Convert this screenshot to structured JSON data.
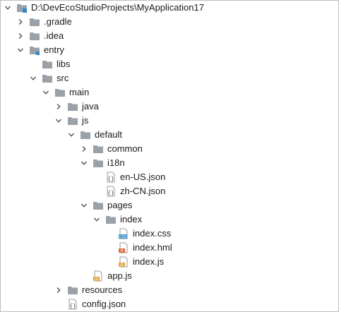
{
  "colors": {
    "folder": "#9aa1a8",
    "arrow": "#4a4a4a",
    "module_dot": "#2f88c9",
    "css_badge": "#3a8fc7",
    "hml_badge": "#e06a3b",
    "js_badge": "#e1a63a",
    "json_border": "#9a9a9a"
  },
  "tree": [
    {
      "label": "D:\\DevEcoStudioProjects\\MyApplication17",
      "depth": 0,
      "arrow": "down",
      "icon": "project-folder-icon"
    },
    {
      "label": ".gradle",
      "depth": 1,
      "arrow": "right",
      "icon": "folder-icon"
    },
    {
      "label": ".idea",
      "depth": 1,
      "arrow": "right",
      "icon": "folder-icon"
    },
    {
      "label": "entry",
      "depth": 1,
      "arrow": "down",
      "icon": "module-folder-icon"
    },
    {
      "label": "libs",
      "depth": 2,
      "arrow": "none",
      "icon": "folder-icon"
    },
    {
      "label": "src",
      "depth": 2,
      "arrow": "down",
      "icon": "folder-icon"
    },
    {
      "label": "main",
      "depth": 3,
      "arrow": "down",
      "icon": "folder-icon"
    },
    {
      "label": "java",
      "depth": 4,
      "arrow": "right",
      "icon": "folder-icon"
    },
    {
      "label": "js",
      "depth": 4,
      "arrow": "down",
      "icon": "folder-icon"
    },
    {
      "label": "default",
      "depth": 5,
      "arrow": "down",
      "icon": "folder-icon"
    },
    {
      "label": "common",
      "depth": 6,
      "arrow": "right",
      "icon": "folder-icon"
    },
    {
      "label": "i18n",
      "depth": 6,
      "arrow": "down",
      "icon": "folder-icon"
    },
    {
      "label": "en-US.json",
      "depth": 7,
      "arrow": "none",
      "icon": "json-file-icon"
    },
    {
      "label": "zh-CN.json",
      "depth": 7,
      "arrow": "none",
      "icon": "json-file-icon"
    },
    {
      "label": "pages",
      "depth": 6,
      "arrow": "down",
      "icon": "folder-icon"
    },
    {
      "label": "index",
      "depth": 7,
      "arrow": "down",
      "icon": "folder-icon"
    },
    {
      "label": "index.css",
      "depth": 8,
      "arrow": "none",
      "icon": "css-file-icon"
    },
    {
      "label": "index.hml",
      "depth": 8,
      "arrow": "none",
      "icon": "hml-file-icon"
    },
    {
      "label": "index.js",
      "depth": 8,
      "arrow": "none",
      "icon": "js-file-icon"
    },
    {
      "label": "app.js",
      "depth": 6,
      "arrow": "none",
      "icon": "js-file-icon"
    },
    {
      "label": "resources",
      "depth": 4,
      "arrow": "right",
      "icon": "folder-icon"
    },
    {
      "label": "config.json",
      "depth": 4,
      "arrow": "none",
      "icon": "json-file-icon"
    }
  ]
}
